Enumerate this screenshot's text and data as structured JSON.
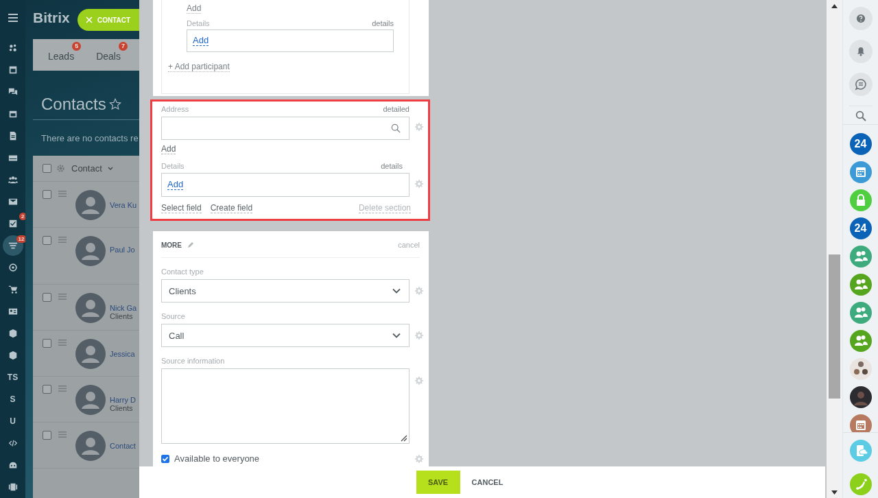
{
  "left_nav": {
    "items": [
      {
        "kind": "icon",
        "selected": false
      },
      {
        "kind": "icon",
        "selected": false
      },
      {
        "kind": "icon",
        "selected": false
      },
      {
        "kind": "icon",
        "selected": false
      },
      {
        "kind": "icon",
        "selected": false
      },
      {
        "kind": "icon",
        "selected": false
      },
      {
        "kind": "icon",
        "selected": false
      },
      {
        "kind": "icon",
        "selected": false
      },
      {
        "kind": "icon",
        "selected": false,
        "badge": "2"
      },
      {
        "kind": "icon",
        "selected": true,
        "badge": "12"
      },
      {
        "kind": "icon",
        "selected": false
      },
      {
        "kind": "icon",
        "selected": false
      },
      {
        "kind": "icon",
        "selected": false
      },
      {
        "kind": "icon",
        "selected": false
      },
      {
        "kind": "icon",
        "selected": false
      },
      {
        "kind": "text",
        "label": "TS",
        "selected": false
      },
      {
        "kind": "text",
        "label": "S",
        "selected": false
      },
      {
        "kind": "text",
        "label": "U",
        "selected": false
      },
      {
        "kind": "icon",
        "selected": false
      },
      {
        "kind": "icon",
        "selected": false
      },
      {
        "kind": "icon",
        "selected": false
      }
    ]
  },
  "header": {
    "title": "Bitrix"
  },
  "crm_tabs": [
    {
      "label": "Leads",
      "badge": "5"
    },
    {
      "label": "Deals",
      "badge": "7"
    }
  ],
  "page_title": "Contacts",
  "empty_notice": "There are no contacts re",
  "list": {
    "column": "Contact",
    "all_checked": false,
    "rows": [
      {
        "name": "Vera Ku",
        "checked": false
      },
      {
        "name": "Paul Jo",
        "checked": false
      },
      {
        "name": "Nick Ga",
        "type": "Clients",
        "checked": false
      },
      {
        "name": "Jessica",
        "checked": false
      },
      {
        "name": "Harry D",
        "type": "Clients",
        "checked": false
      },
      {
        "name": "Contact",
        "checked": false
      }
    ]
  },
  "slider_tab": {
    "label": "CONTACT"
  },
  "participant_section": {
    "add_link": "Add",
    "details_label": "Details",
    "details_link": "details",
    "details_add": "Add",
    "add_participant": "+ Add participant"
  },
  "address_section": {
    "highlighted": true,
    "address_label": "Address",
    "address_link": "detailed",
    "add_link": "Add",
    "details_label": "Details",
    "details_link": "details",
    "details_add": "Add",
    "select_field": "Select field",
    "create_field": "Create field",
    "delete_section": "Delete section"
  },
  "more_section": {
    "title": "MORE",
    "cancel": "cancel",
    "fields": [
      {
        "kind": "select",
        "label": "Contact type",
        "value": "Clients"
      },
      {
        "kind": "select",
        "label": "Source",
        "value": "Call"
      },
      {
        "kind": "textarea",
        "label": "Source information"
      },
      {
        "kind": "checkbox",
        "label": "Available to everyone",
        "checked": true
      }
    ]
  },
  "footer": {
    "buttons": [
      {
        "kind": "primary",
        "label": "SAVE"
      },
      {
        "kind": "link",
        "label": "CANCEL"
      }
    ]
  },
  "right_bar": {
    "items": [
      {
        "kind": "help"
      },
      {
        "kind": "bell"
      },
      {
        "kind": "chat"
      },
      {
        "kind": "search"
      },
      {
        "kind": "text",
        "label": "24",
        "color": "#0b63b8"
      },
      {
        "kind": "calendar",
        "color": "#3c9bd6"
      },
      {
        "kind": "lock",
        "color": "#4fcf3f"
      },
      {
        "kind": "text",
        "label": "24",
        "color": "#0b63b8"
      },
      {
        "kind": "group",
        "color": "#3dab7e"
      },
      {
        "kind": "group",
        "color": "#56a51f"
      },
      {
        "kind": "group",
        "color": "#3dab7e"
      },
      {
        "kind": "group",
        "color": "#56a51f"
      },
      {
        "kind": "people",
        "color": "#e9e4e0"
      },
      {
        "kind": "person",
        "color": "#2b2b30"
      },
      {
        "kind": "calendar",
        "color": "#b77a60"
      },
      {
        "kind": "cloud",
        "color": "#5ccbe4"
      },
      {
        "kind": "phone",
        "color": "#8cd01c"
      }
    ]
  }
}
